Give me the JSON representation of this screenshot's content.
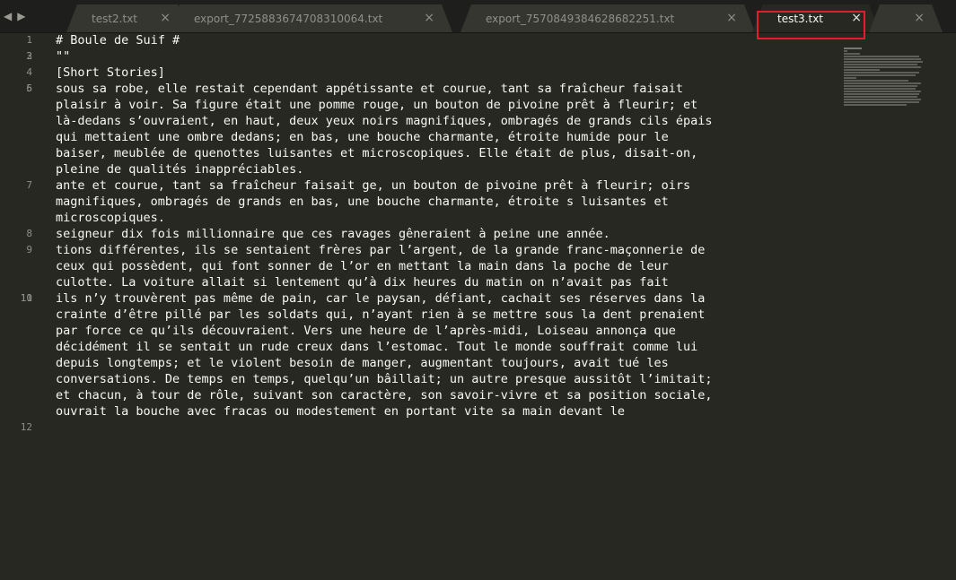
{
  "tabs": [
    {
      "label": "test2.txt",
      "active": false
    },
    {
      "label": "export_7725883674708310064.txt",
      "active": false
    },
    {
      "label": "export_7570849384628682251.txt",
      "active": false
    },
    {
      "label": "test3.txt",
      "active": true
    },
    {
      "label": "",
      "active": false
    }
  ],
  "close_glyph": "×",
  "nav": {
    "back": "◀",
    "forward": "▶"
  },
  "lines": [
    {
      "num": "1",
      "text": "# Boule de Suif #"
    },
    {
      "num": "2",
      "text": ""
    },
    {
      "num": "3",
      "text": "\"\""
    },
    {
      "num": "4",
      "text": "[Short Stories]"
    },
    {
      "num": "5",
      "text": ""
    },
    {
      "num": "6",
      "text": "sous sa robe, elle restait cependant appétissante et courue, tant sa fraîcheur faisait\nplaisir à voir. Sa figure était une pomme rouge, un bouton de pivoine prêt à fleurir; et\nlà-dedans s’ouvraient, en haut, deux yeux noirs magnifiques, ombragés de grands cils épais\nqui mettaient une ombre dedans; en bas, une bouche charmante, étroite humide pour le\nbaiser, meublée de quenottes luisantes et microscopiques. Elle était de plus, disait-on,\npleine de qualités inappréciables."
    },
    {
      "num": "7",
      "text": "ante et courue, tant sa fraîcheur faisait ge, un bouton de pivoine prêt à fleurir; oirs\nmagnifiques, ombragés de grands en bas, une bouche charmante, étroite s luisantes et\nmicroscopiques."
    },
    {
      "num": "8",
      "text": "seigneur dix fois millionnaire que ces ravages gêneraient à peine une année."
    },
    {
      "num": "9",
      "text": "tions différentes, ils se sentaient frères par l’argent, de la grande franc-maçonnerie de\nceux qui possèdent, qui font sonner de l’or en mettant la main dans la poche de leur\nculotte. La voiture allait si lentement qu’à dix heures du matin on n’avait pas fait"
    },
    {
      "num": "10",
      "text": ""
    },
    {
      "num": "11",
      "text": "ils n’y trouvèrent pas même de pain, car le paysan, défiant, cachait ses réserves dans la\ncrainte d’être pillé par les soldats qui, n’ayant rien à se mettre sous la dent prenaient\npar force ce qu’ils découvraient. Vers une heure de l’après-midi, Loiseau annonça que\ndécidément il se sentait un rude creux dans l’estomac. Tout le monde souffrait comme lui\ndepuis longtemps; et le violent besoin de manger, augmentant toujours, avait tué les\nconversations. De temps en temps, quelqu’un bâillait; un autre presque aussitôt l’imitait;\net chacun, à tour de rôle, suivant son caractère, son savoir-vivre et sa position sociale,\nouvrait la bouche avec fracas ou modestement en portant vite sa main devant le"
    },
    {
      "num": "12",
      "text": ""
    }
  ]
}
